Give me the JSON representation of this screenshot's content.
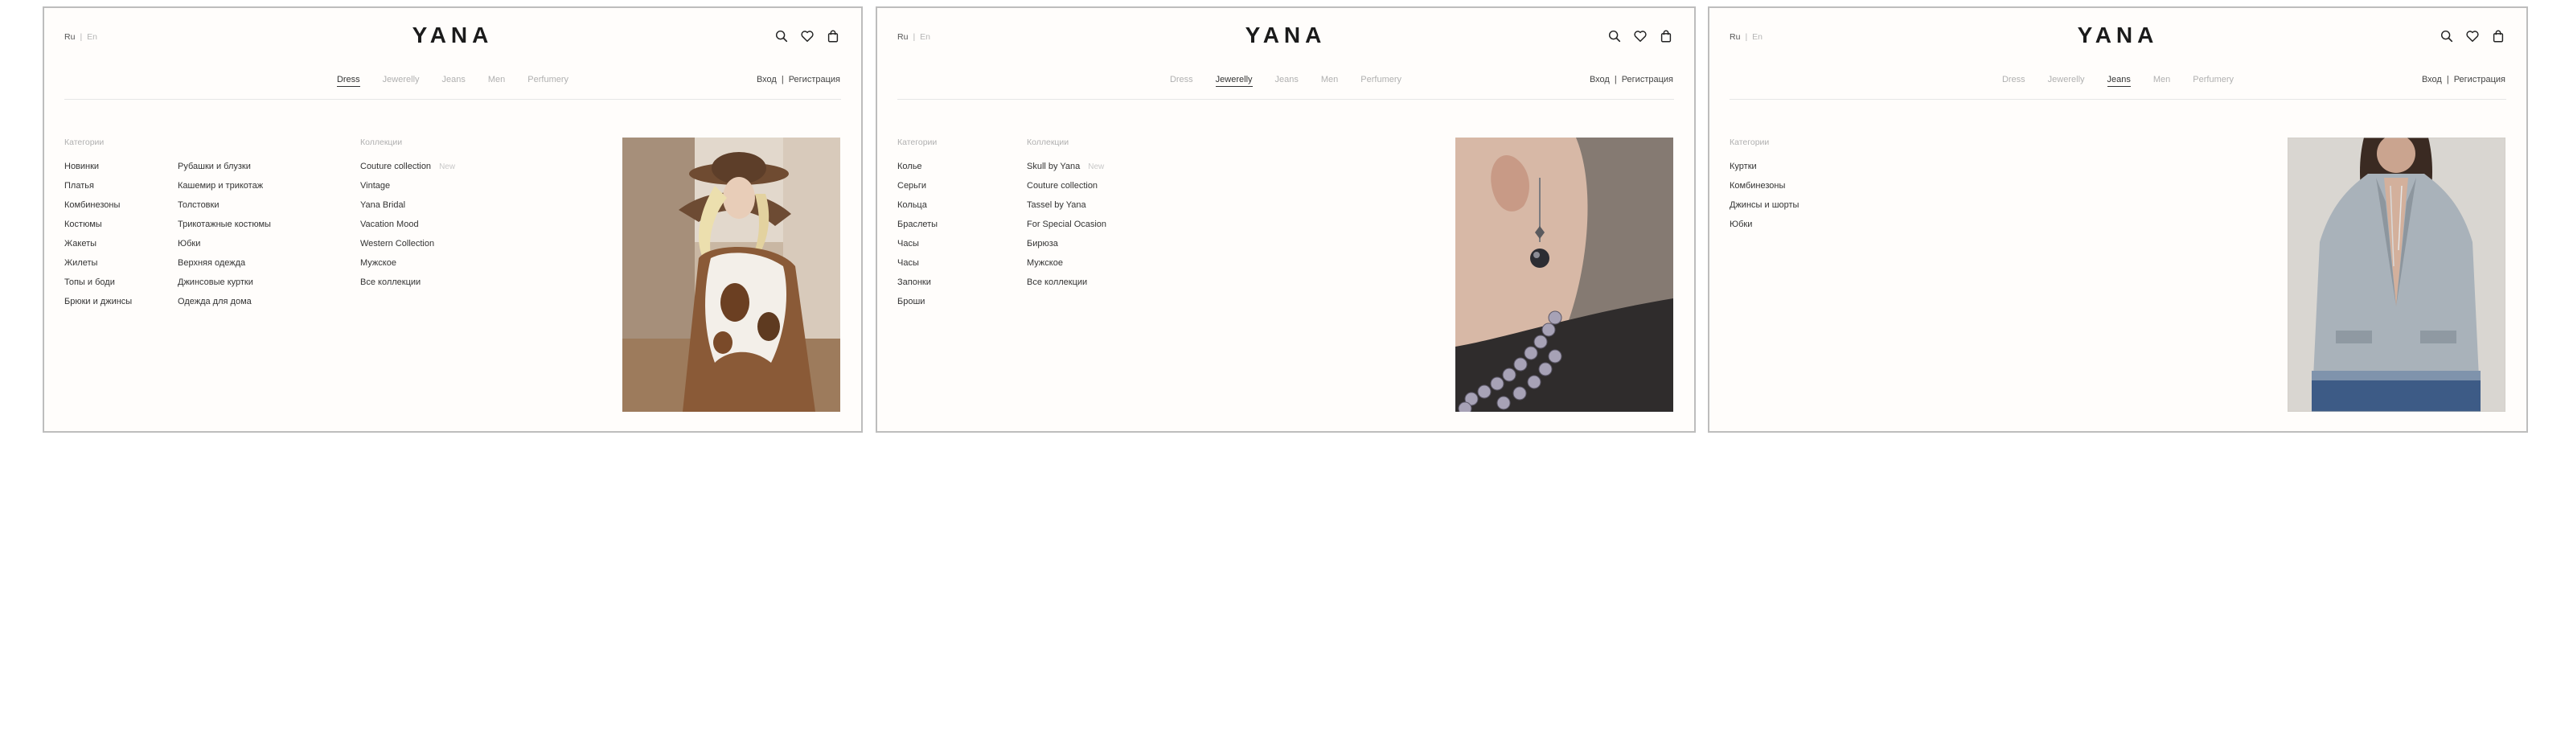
{
  "header": {
    "lang_ru": "Ru",
    "lang_sep": "|",
    "lang_en": "En",
    "logo": "YANA",
    "login": "Вход",
    "auth_sep": "|",
    "register": "Регистрация"
  },
  "icons": [
    "search-icon",
    "heart-icon",
    "bag-icon"
  ],
  "nav": [
    "Dress",
    "Jewerelly",
    "Jeans",
    "Men",
    "Perfumery"
  ],
  "panels": [
    {
      "active_tab": "Dress",
      "categories_title": "Категории",
      "categories_col1": [
        "Новинки",
        "Платья",
        "Комбинезоны",
        "Костюмы",
        "Жакеты",
        "Жилеты",
        "Топы и боди",
        "Брюки и джинсы"
      ],
      "categories_col2": [
        "Рубашки и блузки",
        "Кашемир и трикотаж",
        "Толстовки",
        "Трикотажные костюмы",
        "Юбки",
        "Верхняя одежда",
        "Джинсовые куртки",
        "Одежда для дома"
      ],
      "collections_title": "Коллекции",
      "collections": [
        "Couture collection",
        "Vintage",
        "Yana Bridal",
        "Vacation Mood",
        "Western Collection",
        "Мужское",
        "Все коллекции"
      ],
      "new_badge": "New"
    },
    {
      "active_tab": "Jewerelly",
      "categories_title": "Категории",
      "categories_col1": [
        "Колье",
        "Серьги",
        "Кольца",
        "Браслеты",
        "Часы",
        "Часы",
        "Запонки",
        "Броши"
      ],
      "collections_title": "Коллекции",
      "collections": [
        "Skull by Yana",
        "Couture collection",
        "Tassel by Yana",
        "For Special Ocasion",
        "Бирюза",
        "Мужское",
        "Все коллекции"
      ],
      "new_badge": "New"
    },
    {
      "active_tab": "Jeans",
      "categories_title": "Категории",
      "categories_col1": [
        "Куртки",
        "Комбинезоны",
        "Джинсы и шорты",
        "Юбки"
      ]
    }
  ]
}
